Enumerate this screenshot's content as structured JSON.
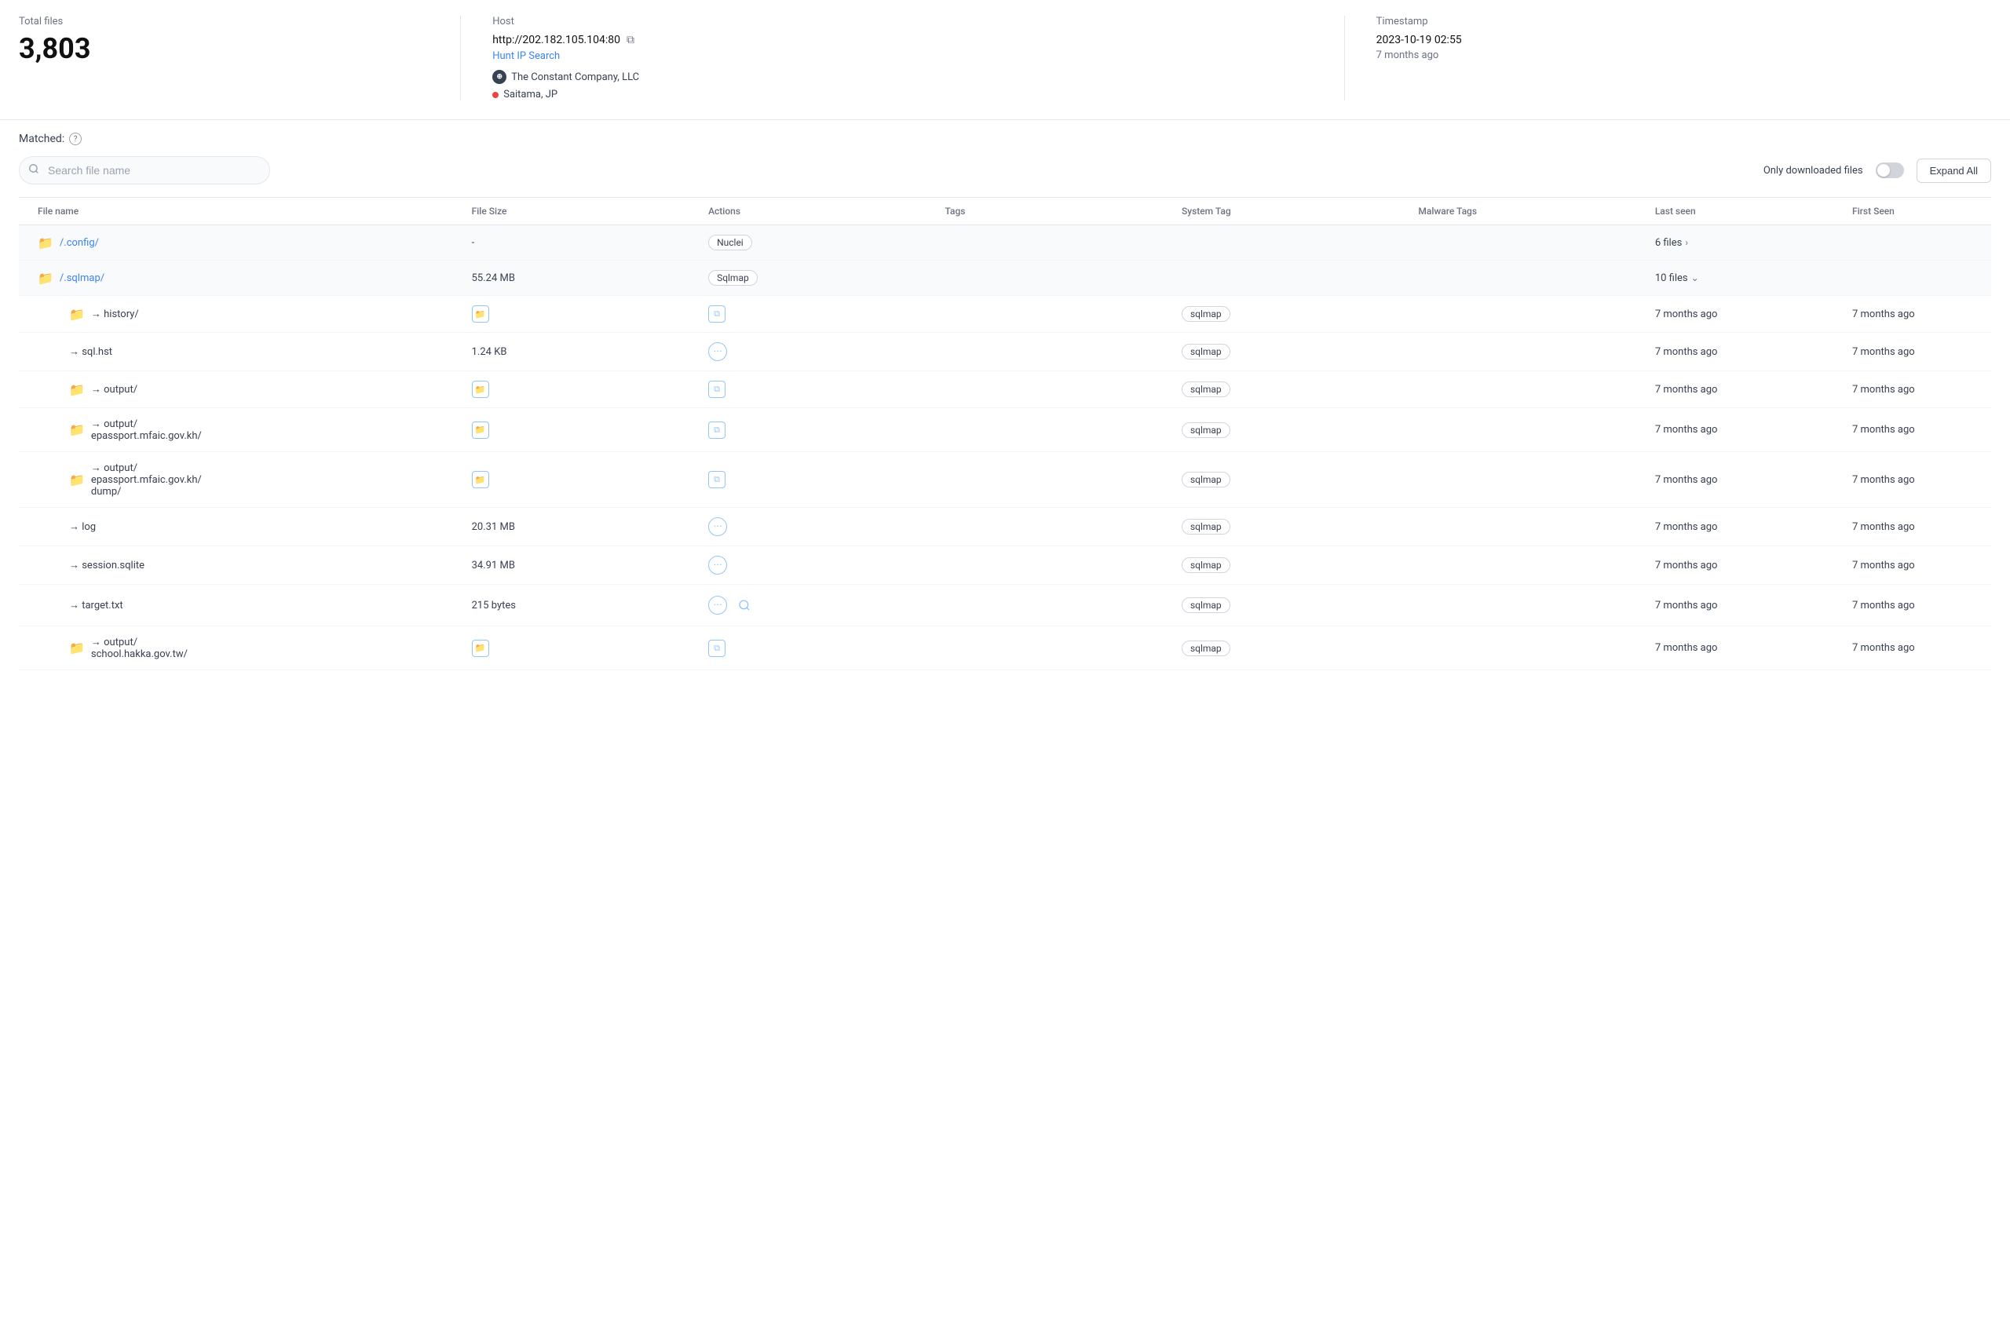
{
  "top": {
    "total_files_label": "Total files",
    "total_files_value": "3,803",
    "host_label": "Host",
    "host_url": "http://202.182.105.104:80",
    "hunt_ip_label": "Hunt IP Search",
    "company_name": "The Constant Company, LLC",
    "location": "Saitama, JP",
    "timestamp_label": "Timestamp",
    "timestamp_value": "2023-10-19 02:55",
    "timestamp_ago": "7 months ago"
  },
  "matched": {
    "label": "Matched:",
    "search_placeholder": "Search file name",
    "only_downloaded_label": "Only downloaded files",
    "expand_all_label": "Expand All"
  },
  "table": {
    "headers": [
      "File name",
      "File Size",
      "Actions",
      "Tags",
      "System Tag",
      "Malware Tags",
      "Last seen",
      "First Seen"
    ],
    "rows": [
      {
        "id": "config",
        "name": "/.config/",
        "is_folder": true,
        "file_size": "-",
        "action_tag": "Nuclei",
        "tags": "",
        "system_tag": "",
        "malware_tags": "",
        "files_count": "6 files",
        "expanded": false,
        "last_seen": "",
        "first_seen": "",
        "children": []
      },
      {
        "id": "sqlmap",
        "name": "/.sqlmap/",
        "is_folder": true,
        "file_size": "55.24 MB",
        "action_tag": "Sqlmap",
        "tags": "",
        "system_tag": "",
        "malware_tags": "",
        "files_count": "10 files",
        "expanded": true,
        "last_seen": "",
        "first_seen": "",
        "children": [
          {
            "name": "→ history/",
            "is_folder": true,
            "file_size": "",
            "has_folder_action": true,
            "has_copy_action": true,
            "tags": "",
            "system_tag": "sqlmap",
            "malware_tags": "",
            "last_seen": "7 months ago",
            "first_seen": "7 months ago"
          },
          {
            "name": "→ sql.hst",
            "is_folder": false,
            "file_size": "1.24 KB",
            "has_menu_action": true,
            "tags": "",
            "system_tag": "sqlmap",
            "malware_tags": "",
            "last_seen": "7 months ago",
            "first_seen": "7 months ago"
          },
          {
            "name": "→ output/",
            "is_folder": true,
            "file_size": "",
            "has_folder_action": true,
            "has_copy_action": true,
            "tags": "",
            "system_tag": "sqlmap",
            "malware_tags": "",
            "last_seen": "7 months ago",
            "first_seen": "7 months ago"
          },
          {
            "name": "→ output/\nepassport.mfaic.gov.kh/",
            "display_name": "→ output/epassport.mfaic.gov.kh/",
            "is_folder": true,
            "file_size": "",
            "has_folder_action": true,
            "has_copy_action": true,
            "tags": "",
            "system_tag": "sqlmap",
            "malware_tags": "",
            "last_seen": "7 months ago",
            "first_seen": "7 months ago"
          },
          {
            "name": "→ output/\nepassport.mfaic.gov.kh/\ndump/",
            "display_name": "→ output/epassport.mfaic.gov.kh/dump/",
            "is_folder": true,
            "file_size": "",
            "has_folder_action": true,
            "has_copy_action": true,
            "tags": "",
            "system_tag": "sqlmap",
            "malware_tags": "",
            "last_seen": "7 months ago",
            "first_seen": "7 months ago"
          },
          {
            "name": "→ log",
            "is_folder": false,
            "file_size": "20.31 MB",
            "has_menu_action": true,
            "tags": "",
            "system_tag": "sqlmap",
            "malware_tags": "",
            "last_seen": "7 months ago",
            "first_seen": "7 months ago"
          },
          {
            "name": "→ session.sqlite",
            "is_folder": false,
            "file_size": "34.91 MB",
            "has_menu_action": true,
            "tags": "",
            "system_tag": "sqlmap",
            "malware_tags": "",
            "last_seen": "7 months ago",
            "first_seen": "7 months ago"
          },
          {
            "name": "→ target.txt",
            "is_folder": false,
            "file_size": "215 bytes",
            "has_menu_action": true,
            "has_search_action": true,
            "tags": "",
            "system_tag": "sqlmap",
            "malware_tags": "",
            "last_seen": "7 months ago",
            "first_seen": "7 months ago"
          },
          {
            "name": "→ output/\nschool.hakka.gov.tw/",
            "display_name": "→ output/school.hakka.gov.tw/",
            "is_folder": true,
            "file_size": "",
            "has_folder_action": true,
            "has_copy_action": true,
            "tags": "",
            "system_tag": "sqlmap",
            "malware_tags": "",
            "last_seen": "7 months ago",
            "first_seen": "7 months ago"
          }
        ]
      }
    ]
  }
}
